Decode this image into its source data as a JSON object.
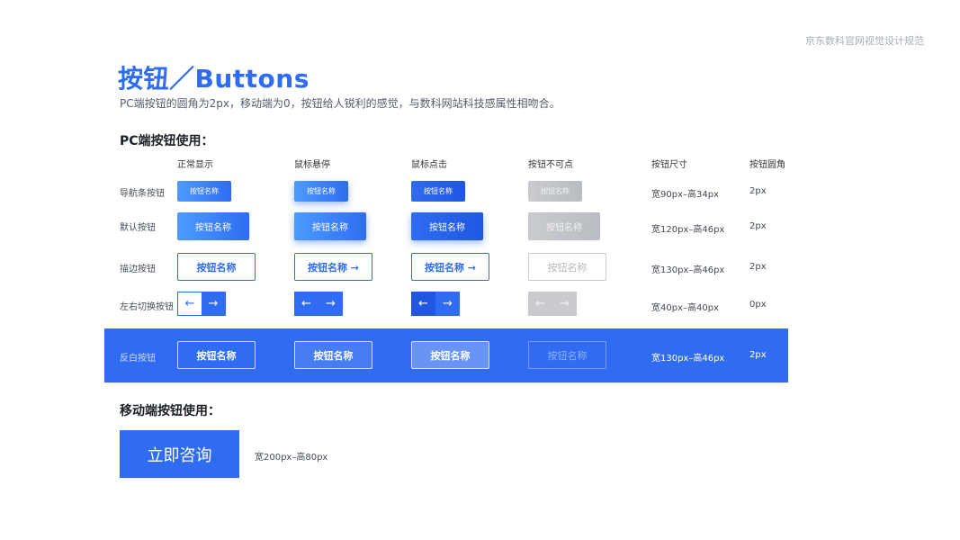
{
  "brand": "京东数科官网视觉设计规范",
  "title": "按钮／Buttons",
  "subtitle": "PC端按钮的圆角为2px，移动端为0，按钮给人锐利的感觉，与数科网站科技感属性相吻合。",
  "pc_section": "PC端按钮使用：",
  "columns": {
    "normal": "正常显示",
    "hover": "鼠标悬停",
    "click": "鼠标点击",
    "disabled": "按钮不可点",
    "size": "按钮尺寸",
    "radius": "按钮圆角"
  },
  "rows": {
    "nav": {
      "label": "导航条按钮",
      "button": "按钮名称",
      "size": "宽90px–高34px",
      "radius": "2px"
    },
    "default": {
      "label": "默认按钮",
      "button": "按钮名称",
      "size": "宽120px–高46px",
      "radius": "2px"
    },
    "outline": {
      "label": "描边按钮",
      "button": "按钮名称",
      "button_arrow": "按钮名称 →",
      "size": "宽130px–高46px",
      "radius": "2px"
    },
    "switch": {
      "label": "左右切换按钮",
      "left": "←",
      "right": "→",
      "size": "宽40px–高40px",
      "radius": "0px"
    },
    "inverse": {
      "label": "反白按钮",
      "button": "按钮名称",
      "size": "宽130px–高46px",
      "radius": "2px"
    }
  },
  "mobile_section": "移动端按钮使用：",
  "mobile": {
    "button": "立即咨询",
    "size": "宽200px–高80px"
  },
  "colors": {
    "primary": "#2f6cf1",
    "disabled": "#c9cbcf"
  }
}
